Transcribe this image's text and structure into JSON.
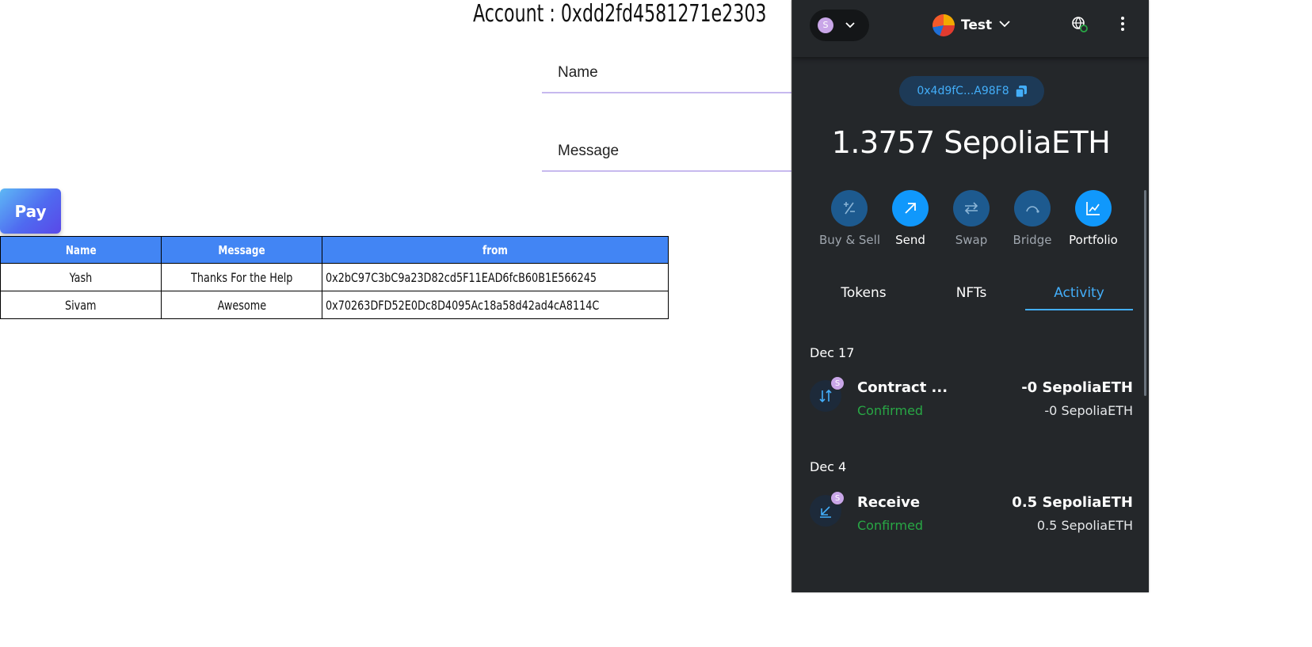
{
  "dapp": {
    "account_label": "Account : 0xdd2fd4581271e2303",
    "name_placeholder": "Name",
    "message_placeholder": "Message",
    "pay_label": "Pay",
    "table": {
      "headers": [
        "Name",
        "Message",
        "from"
      ],
      "rows": [
        {
          "name": "Yash",
          "message": "Thanks For the Help",
          "from": "0x2bC97C3bC9a23D82cd5F11EAD6fcB60B1E566245"
        },
        {
          "name": "Sivam",
          "message": "Awesome",
          "from": "0x70263DFD52E0Dc8D4095Ac18a58d42ad4cA8114C"
        }
      ]
    }
  },
  "metamask": {
    "network_avatar": "S",
    "account_name": "Test",
    "address_short": "0x4d9fC...A98F8",
    "balance": "1.3757 SepoliaETH",
    "actions": [
      {
        "label": "Buy & Sell",
        "icon": "plus-minus-icon",
        "enabled": false
      },
      {
        "label": "Send",
        "icon": "arrow-up-right-icon",
        "enabled": true
      },
      {
        "label": "Swap",
        "icon": "swap-arrows-icon",
        "enabled": false
      },
      {
        "label": "Bridge",
        "icon": "bridge-icon",
        "enabled": false
      },
      {
        "label": "Portfolio",
        "icon": "chart-icon",
        "enabled": true
      }
    ],
    "tabs": [
      "Tokens",
      "NFTs",
      "Activity"
    ],
    "active_tab": "Activity",
    "activity": [
      {
        "date": "Dec 17",
        "title": "Contract ...",
        "status": "Confirmed",
        "amount": "-0 SepoliaETH",
        "fiat": "-0 SepoliaETH",
        "badge": "S",
        "icon": "contract-interaction-icon"
      },
      {
        "date": "Dec 4",
        "title": "Receive",
        "status": "Confirmed",
        "amount": "0.5 SepoliaETH",
        "fiat": "0.5 SepoliaETH",
        "badge": "S",
        "icon": "receive-arrow-icon"
      }
    ],
    "colors": {
      "accent": "#43aef9",
      "confirmed": "#28a745",
      "background": "#24272a"
    }
  }
}
